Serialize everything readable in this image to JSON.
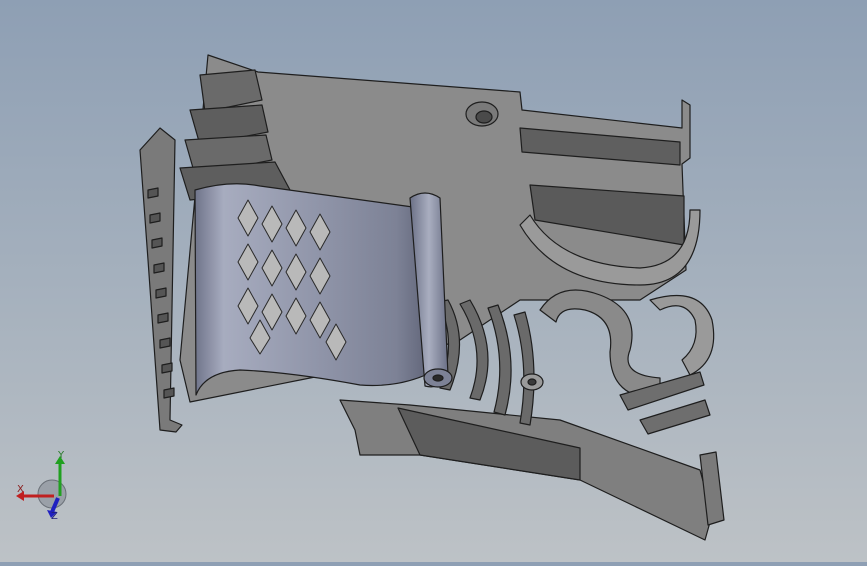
{
  "viewport": {
    "background_top": "#8e9fb4",
    "background_bottom": "#bdc2c6",
    "part_color": "#8a8a8a",
    "part_dark": "#5e5e5e",
    "part_outline": "#1e1e1e",
    "cover_color": "#8f94a8"
  },
  "triad": {
    "x_label": "X",
    "y_label": "Y",
    "z_label": "Z",
    "x_color": "#c02020",
    "y_color": "#20a020",
    "z_color": "#2020c0"
  }
}
